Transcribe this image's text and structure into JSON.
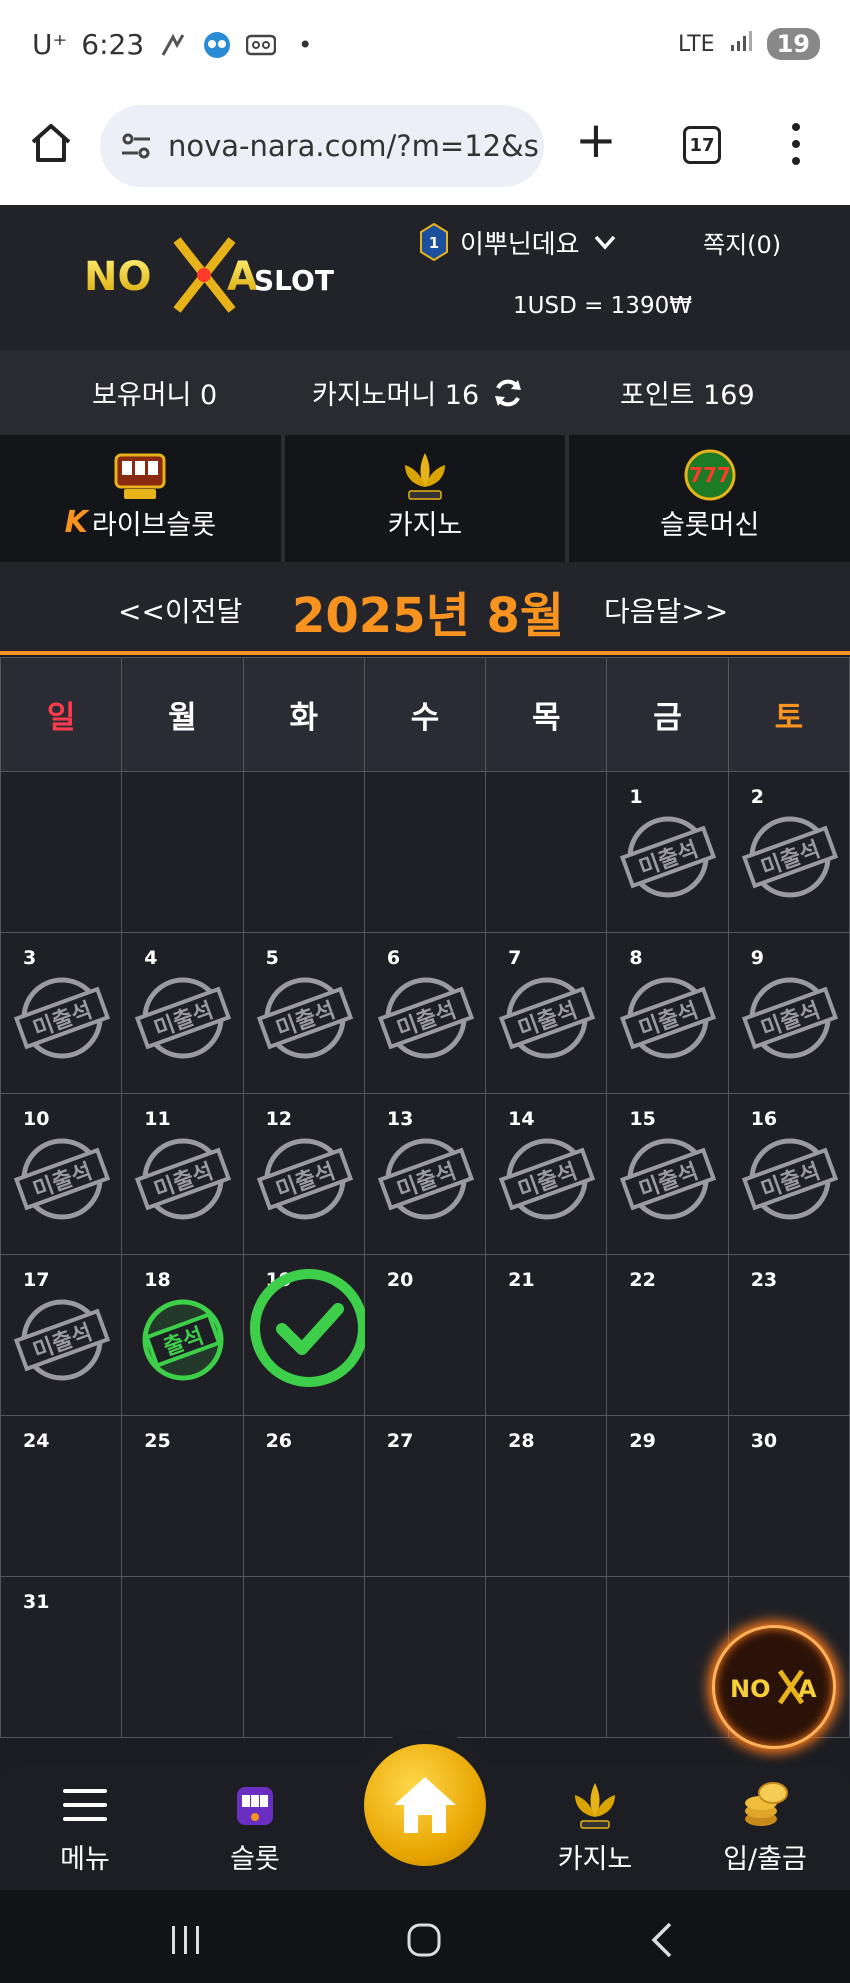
{
  "status_bar": {
    "carrier": "U⁺",
    "time": "6:23",
    "network": "LTE",
    "battery": "19",
    "icons": [
      "gesture-icon",
      "avatar-icon",
      "voicemail-icon",
      "dot-icon",
      "signal-icon"
    ]
  },
  "browser": {
    "url": "nova-nara.com/?m=12&s",
    "tab_count": "17"
  },
  "header": {
    "logo_text": "NOVA SLOT",
    "level": "1",
    "username": "이뿌닌데요",
    "messages": "쪽지(0)",
    "exchange_rate": "1USD = 1390₩"
  },
  "money": {
    "holding": "보유머니 0",
    "casino": "카지노머니 16",
    "points": "포인트 169"
  },
  "categories": [
    {
      "label": "라이브슬롯",
      "prefix": "K"
    },
    {
      "label": "카지노"
    },
    {
      "label": "슬롯머신"
    }
  ],
  "month_nav": {
    "prev": "<<이전달",
    "current": "2025년 8월",
    "next": "다음달>>"
  },
  "calendar": {
    "weekdays": [
      "일",
      "월",
      "화",
      "수",
      "목",
      "금",
      "토"
    ],
    "absent_label": "미출석",
    "present_label": "출석",
    "weeks": [
      [
        null,
        null,
        null,
        null,
        null,
        {
          "d": "1",
          "s": "absent"
        },
        {
          "d": "2",
          "s": "absent"
        }
      ],
      [
        {
          "d": "3",
          "s": "absent"
        },
        {
          "d": "4",
          "s": "absent"
        },
        {
          "d": "5",
          "s": "absent"
        },
        {
          "d": "6",
          "s": "absent"
        },
        {
          "d": "7",
          "s": "absent"
        },
        {
          "d": "8",
          "s": "absent"
        },
        {
          "d": "9",
          "s": "absent"
        }
      ],
      [
        {
          "d": "10",
          "s": "absent"
        },
        {
          "d": "11",
          "s": "absent"
        },
        {
          "d": "12",
          "s": "absent"
        },
        {
          "d": "13",
          "s": "absent"
        },
        {
          "d": "14",
          "s": "absent"
        },
        {
          "d": "15",
          "s": "absent"
        },
        {
          "d": "16",
          "s": "absent"
        }
      ],
      [
        {
          "d": "17",
          "s": "absent"
        },
        {
          "d": "18",
          "s": "present"
        },
        {
          "d": "19",
          "s": "check"
        },
        {
          "d": "20",
          "s": ""
        },
        {
          "d": "21",
          "s": ""
        },
        {
          "d": "22",
          "s": ""
        },
        {
          "d": "23",
          "s": ""
        }
      ],
      [
        {
          "d": "24",
          "s": ""
        },
        {
          "d": "25",
          "s": ""
        },
        {
          "d": "26",
          "s": ""
        },
        {
          "d": "27",
          "s": ""
        },
        {
          "d": "28",
          "s": ""
        },
        {
          "d": "29",
          "s": ""
        },
        {
          "d": "30",
          "s": ""
        }
      ],
      [
        {
          "d": "31",
          "s": ""
        },
        null,
        null,
        null,
        null,
        null,
        null
      ]
    ]
  },
  "bottom_nav": {
    "menu": "메뉴",
    "slot": "슬롯",
    "casino": "카지노",
    "deposit": "입/출금"
  },
  "colors": {
    "accent": "#f7931e",
    "sunday": "#ff3b4e",
    "present": "#3ecf4a",
    "background": "#1c1d22"
  }
}
